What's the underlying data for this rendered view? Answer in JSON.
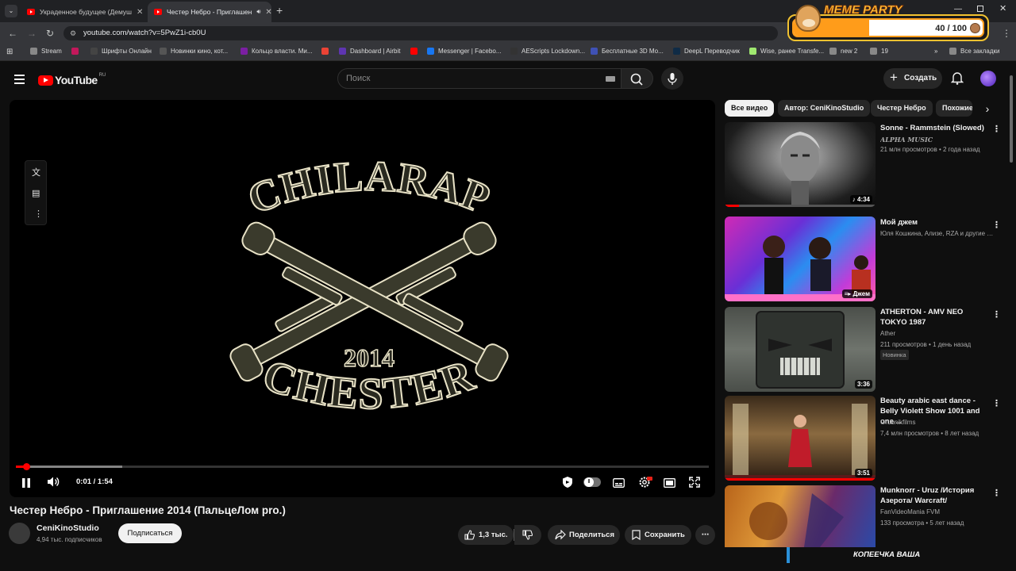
{
  "browser": {
    "tabs": [
      {
        "title": "Украденное будущее (Демуш"
      },
      {
        "title": "Честер Небро - Приглашен"
      }
    ],
    "url": "youtube.com/watch?v=5PwZ1i-cb0U",
    "bookmarks": [
      {
        "label": "Stream",
        "color": "#888"
      },
      {
        "label": "",
        "color": "#c2185b"
      },
      {
        "label": "Шрифты Онлайн",
        "color": "#444"
      },
      {
        "label": "Новинки кино, кот...",
        "color": "#555"
      },
      {
        "label": "Кольцо власти. Ми...",
        "color": "#7b1fa2"
      },
      {
        "label": "",
        "color": "#ea4335"
      },
      {
        "label": "Dashboard | Airbit",
        "color": "#5e35b1"
      },
      {
        "label": "",
        "color": "#ff0000"
      },
      {
        "label": "Messenger | Facebo...",
        "color": "#1877f2"
      },
      {
        "label": "AEScripts Lockdown...",
        "color": "#333"
      },
      {
        "label": "Бесплатные 3D Мо...",
        "color": "#3f51b5"
      },
      {
        "label": "DeepL Переводчик",
        "color": "#0f2b46"
      },
      {
        "label": "Wise, ранее Transfe...",
        "color": "#9fe870"
      },
      {
        "label": "new 2",
        "color": "#888"
      },
      {
        "label": "19",
        "color": "#888"
      }
    ],
    "all_bookmarks": "Все закладки"
  },
  "meme_party": {
    "title": "MEME PARTY",
    "count": "40 / 100",
    "progress": 0.4
  },
  "youtube": {
    "logo_text": "YouTube",
    "region": "RU",
    "search_placeholder": "Поиск",
    "create_label": "Создать"
  },
  "player": {
    "artwork_top": "CHILARAP",
    "artwork_year": "2014",
    "artwork_bottom": "CHESTER",
    "time": "0:01 / 1:54",
    "played_fraction": 0.015
  },
  "video": {
    "title": "Честер Небро - Приглашение 2014 (ПальцеЛом pro.)",
    "channel": "CeniKinoStudio",
    "subscribers": "4,94 тыс. подписчиков",
    "subscribe_label": "Подписаться",
    "likes": "1,3 тыс.",
    "share_label": "Поделиться",
    "save_label": "Сохранить"
  },
  "sidebar": {
    "chips": [
      "Все видео",
      "Автор: CeniKinoStudio",
      "Честер Небро",
      "Похожие"
    ],
    "items": [
      {
        "title": "Sonne - Rammstein (Slowed)",
        "channel": "ALPHA MUSIC",
        "meta": "21 млн просмотров • 2 года назад",
        "duration": "♪ 4:34",
        "badge": ""
      },
      {
        "title": "Мой джем",
        "channel": "Юля Кошкина, Ализе, RZA и другие ис...",
        "meta": "",
        "duration": "≡▸ Джем",
        "badge": ""
      },
      {
        "title": "ATHERTON - AMV NEO TOKYO 1987",
        "channel": "Ather",
        "meta": "211 просмотров • 1 день назад",
        "duration": "3:36",
        "badge": "Новинка"
      },
      {
        "title": "Beauty arabic east dance - Belly Violett Show 1001 and one ...",
        "channel": "Grubnikfilms",
        "meta": "7,4 млн просмотров • 8 лет назад",
        "duration": "3:51",
        "badge": ""
      },
      {
        "title": "Munknorr - Uruz /История Азерота/ Warcraft/",
        "channel": "FanVideoMania FVM",
        "meta": "133 просмотра • 5 лет назад",
        "duration": "",
        "badge": ""
      }
    ]
  },
  "overlay_text": "КОПЕЕЧКА ВАША"
}
